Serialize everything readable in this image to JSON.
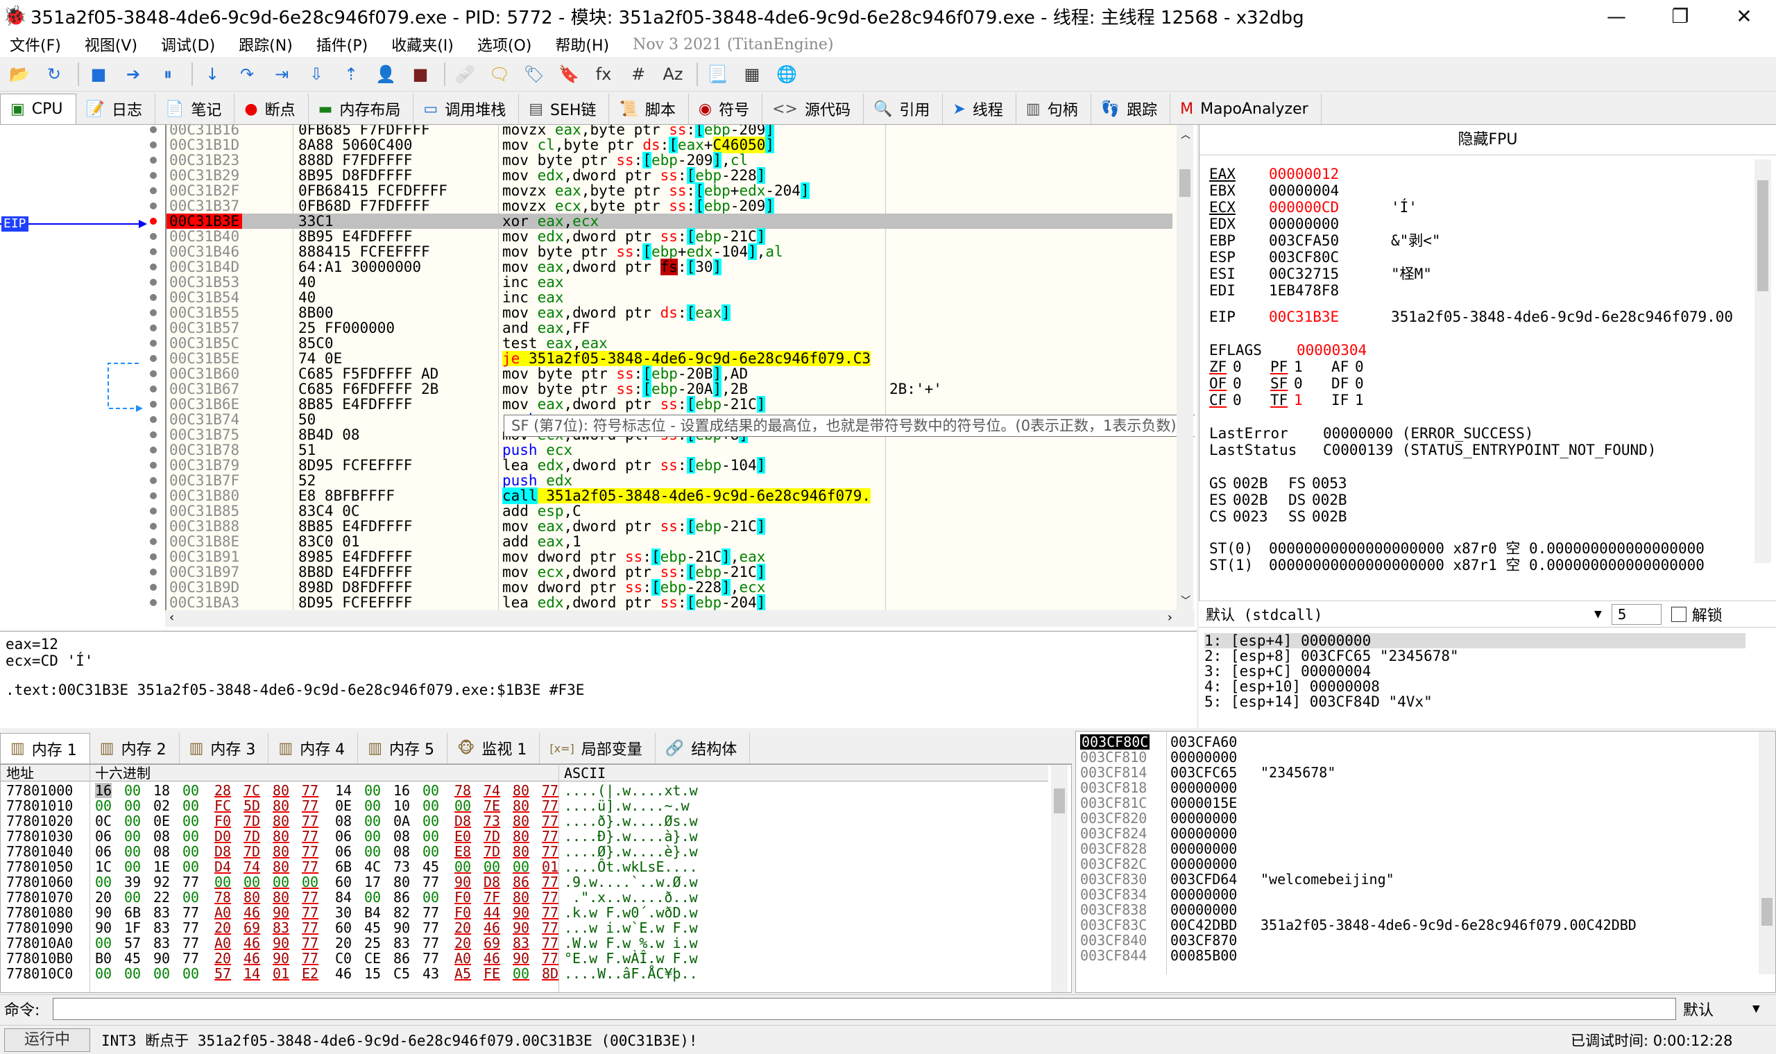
{
  "title": {
    "text": "351a2f05-3848-4de6-9c9d-6e28c946f079.exe - PID: 5772 - 模块: 351a2f05-3848-4de6-9c9d-6e28c946f079.exe - 线程: 主线程 12568 - x32dbg"
  },
  "window_buttons": {
    "minimize": "—",
    "maximize": "❐",
    "close": "✕"
  },
  "menu": [
    "文件(F)",
    "视图(V)",
    "调试(D)",
    "跟踪(N)",
    "插件(P)",
    "收藏夹(I)",
    "选项(O)",
    "帮助(H)"
  ],
  "menu_date": "Nov 3 2021 (TitanEngine)",
  "toolbar_icons": [
    "open-icon",
    "restart-icon",
    "stop-icon",
    "run-icon",
    "pause-icon",
    "step-into-icon",
    "step-over-icon",
    "trace-into-icon",
    "trace-over-icon",
    "execute-till-return-icon",
    "run-to-user-code-icon",
    "scylla-icon",
    "patch-icon",
    "comment-icon",
    "label-icon",
    "bookmark-icon",
    "function-icon",
    "hash-icon",
    "font-icon",
    "script-icon",
    "calculator-icon",
    "globe-icon"
  ],
  "toolbar_glyphs": [
    "📂",
    "↻",
    "■",
    "➔",
    "⏸",
    "↓",
    "↷",
    "⇥",
    "⇩",
    "⇡",
    "👤",
    "■",
    "🩹",
    "🗨",
    "🏷",
    "🔖",
    "fx",
    "#",
    "Az",
    "📃",
    "▦",
    "🌐"
  ],
  "tabs": [
    {
      "label": "CPU",
      "icon": "cpu-icon",
      "glyph": "▣"
    },
    {
      "label": "日志",
      "icon": "log-icon",
      "glyph": "📝"
    },
    {
      "label": "笔记",
      "icon": "notes-icon",
      "glyph": "📄"
    },
    {
      "label": "断点",
      "icon": "breakpoint-icon",
      "glyph": "●"
    },
    {
      "label": "内存布局",
      "icon": "memory-map-icon",
      "glyph": "▬"
    },
    {
      "label": "调用堆栈",
      "icon": "call-stack-icon",
      "glyph": "▭"
    },
    {
      "label": "SEH链",
      "icon": "seh-icon",
      "glyph": "▤"
    },
    {
      "label": "脚本",
      "icon": "script-icon",
      "glyph": "📜"
    },
    {
      "label": "符号",
      "icon": "symbol-icon",
      "glyph": "◉"
    },
    {
      "label": "源代码",
      "icon": "source-icon",
      "glyph": "<>"
    },
    {
      "label": "引用",
      "icon": "reference-icon",
      "glyph": "🔍"
    },
    {
      "label": "线程",
      "icon": "thread-icon",
      "glyph": "➤"
    },
    {
      "label": "句柄",
      "icon": "handle-icon",
      "glyph": "▥"
    },
    {
      "label": "跟踪",
      "icon": "trace-icon",
      "glyph": "👣"
    },
    {
      "label": "MapoAnalyzer",
      "icon": "mapo-icon",
      "glyph": "M"
    }
  ],
  "eip_label": "EIP",
  "disasm": [
    {
      "addr": "00C31B16",
      "bytes": "0FB685 F7FDFFFF",
      "instr": "movzx eax,byte ptr ss:[ebp-209]",
      "cmt": ""
    },
    {
      "addr": "00C31B1D",
      "bytes": "8A88 5060C400",
      "instr": "mov cl,byte ptr ds:[eax+C46050]",
      "cmt": ""
    },
    {
      "addr": "00C31B23",
      "bytes": "888D F7FDFFFF",
      "instr": "mov byte ptr ss:[ebp-209],cl",
      "cmt": ""
    },
    {
      "addr": "00C31B29",
      "bytes": "8B95 D8FDFFFF",
      "instr": "mov edx,dword ptr ss:[ebp-228]",
      "cmt": ""
    },
    {
      "addr": "00C31B2F",
      "bytes": "0FB68415 FCFDFFFF",
      "instr": "movzx eax,byte ptr ss:[ebp+edx-204]",
      "cmt": ""
    },
    {
      "addr": "00C31B37",
      "bytes": "0FB68D F7FDFFFF",
      "instr": "movzx ecx,byte ptr ss:[ebp-209]",
      "cmt": ""
    },
    {
      "addr": "00C31B3E",
      "bytes": "33C1",
      "instr": "xor eax,ecx",
      "cmt": ""
    },
    {
      "addr": "00C31B40",
      "bytes": "8B95 E4FDFFFF",
      "instr": "mov edx,dword ptr ss:[ebp-21C]",
      "cmt": ""
    },
    {
      "addr": "00C31B46",
      "bytes": "888415 FCFEFFFF",
      "instr": "mov byte ptr ss:[ebp+edx-104],al",
      "cmt": ""
    },
    {
      "addr": "00C31B4D",
      "bytes": "64:A1 30000000",
      "instr": "mov eax,dword ptr fs:[30]",
      "cmt": ""
    },
    {
      "addr": "00C31B53",
      "bytes": "40",
      "instr": "inc eax",
      "cmt": ""
    },
    {
      "addr": "00C31B54",
      "bytes": "40",
      "instr": "inc eax",
      "cmt": ""
    },
    {
      "addr": "00C31B55",
      "bytes": "8B00",
      "instr": "mov eax,dword ptr ds:[eax]",
      "cmt": ""
    },
    {
      "addr": "00C31B57",
      "bytes": "25 FF000000",
      "instr": "and eax,FF",
      "cmt": ""
    },
    {
      "addr": "00C31B5C",
      "bytes": "85C0",
      "instr": "test eax,eax",
      "cmt": ""
    },
    {
      "addr": "00C31B5E",
      "bytes": "74 0E",
      "instr": "je 351a2f05-3848-4de6-9c9d-6e28c946f079.C3",
      "cmt": ""
    },
    {
      "addr": "00C31B60",
      "bytes": "C685 F5FDFFFF AD",
      "instr": "mov byte ptr ss:[ebp-20B],AD",
      "cmt": ""
    },
    {
      "addr": "00C31B67",
      "bytes": "C685 F6FDFFFF 2B",
      "instr": "mov byte ptr ss:[ebp-20A],2B",
      "cmt": "2B:'+'"
    },
    {
      "addr": "00C31B6E",
      "bytes": "8B85 E4FDFFFF",
      "instr": "mov eax,dword ptr ss:[ebp-21C]",
      "cmt": ""
    },
    {
      "addr": "00C31B74",
      "bytes": "50",
      "instr": "push eax",
      "cmt": ""
    },
    {
      "addr": "00C31B75",
      "bytes": "8B4D 08",
      "instr": "mov ecx,dword ptr ss:[ebp+8]",
      "cmt": ""
    },
    {
      "addr": "00C31B78",
      "bytes": "51",
      "instr": "push ecx",
      "cmt": ""
    },
    {
      "addr": "00C31B79",
      "bytes": "8D95 FCFEFFFF",
      "instr": "lea edx,dword ptr ss:[ebp-104]",
      "cmt": ""
    },
    {
      "addr": "00C31B7F",
      "bytes": "52",
      "instr": "push edx",
      "cmt": ""
    },
    {
      "addr": "00C31B80",
      "bytes": "E8 8BFBFFFF",
      "instr": "call 351a2f05-3848-4de6-9c9d-6e28c946f079.",
      "cmt": ""
    },
    {
      "addr": "00C31B85",
      "bytes": "83C4 0C",
      "instr": "add esp,C",
      "cmt": ""
    },
    {
      "addr": "00C31B88",
      "bytes": "8B85 E4FDFFFF",
      "instr": "mov eax,dword ptr ss:[ebp-21C]",
      "cmt": ""
    },
    {
      "addr": "00C31B8E",
      "bytes": "83C0 01",
      "instr": "add eax,1",
      "cmt": ""
    },
    {
      "addr": "00C31B91",
      "bytes": "8985 E4FDFFFF",
      "instr": "mov dword ptr ss:[ebp-21C],eax",
      "cmt": ""
    },
    {
      "addr": "00C31B97",
      "bytes": "8B8D E4FDFFFF",
      "instr": "mov ecx,dword ptr ss:[ebp-21C]",
      "cmt": ""
    },
    {
      "addr": "00C31B9D",
      "bytes": "898D D8FDFFFF",
      "instr": "mov dword ptr ss:[ebp-228],ecx",
      "cmt": ""
    },
    {
      "addr": "00C31BA3",
      "bytes": "8D95 FCFEFFFF",
      "instr": "lea edx,dword ptr ss:[ebp-204]",
      "cmt": ""
    }
  ],
  "tooltip": "SF (第7位): 符号标志位 - 设置成结果的最高位，也就是带符号数中的符号位。(0表示正数，1表示负数)",
  "fpu_header": "隐藏FPU",
  "registers": [
    {
      "name": "EAX",
      "value": "00000012",
      "comment": "",
      "changed": true
    },
    {
      "name": "EBX",
      "value": "00000004",
      "comment": "",
      "changed": false
    },
    {
      "name": "ECX",
      "value": "000000CD",
      "comment": "'Í'",
      "changed": true
    },
    {
      "name": "EDX",
      "value": "00000000",
      "comment": "",
      "changed": false
    },
    {
      "name": "EBP",
      "value": "003CFA50",
      "comment": "&\"剥<\"",
      "changed": false
    },
    {
      "name": "ESP",
      "value": "003CF80C",
      "comment": "",
      "changed": false
    },
    {
      "name": "ESI",
      "value": "00C32715",
      "comment": "\"柽M\"",
      "changed": false
    },
    {
      "name": "EDI",
      "value": "1EB478F8",
      "comment": "",
      "changed": false
    }
  ],
  "eip_reg": {
    "name": "EIP",
    "value": "00C31B3E",
    "comment": "351a2f05-3848-4de6-9c9d-6e28c946f079.00"
  },
  "eflags": {
    "name": "EFLAGS",
    "value": "00000304"
  },
  "flags": [
    [
      "ZF",
      "0",
      "PF",
      "1",
      "AF",
      "0"
    ],
    [
      "OF",
      "0",
      "SF",
      "0",
      "DF",
      "0"
    ],
    [
      "CF",
      "0",
      "TF",
      "1",
      "IF",
      "1"
    ]
  ],
  "lasterror": {
    "label": "LastError",
    "value": "00000000 (ERROR_SUCCESS)"
  },
  "laststatus": {
    "label": "LastStatus",
    "value": "C0000139 (STATUS_ENTRYPOINT_NOT_FOUND)"
  },
  "segs": [
    [
      "GS",
      "002B",
      "FS",
      "0053"
    ],
    [
      "ES",
      "002B",
      "DS",
      "002B"
    ],
    [
      "CS",
      "0023",
      "SS",
      "002B"
    ]
  ],
  "st": [
    {
      "name": "ST(0)",
      "value": "00000000000000000000 x87r0 空 0.000000000000000000"
    },
    {
      "name": "ST(1)",
      "value": "00000000000000000000 x87r1 空 0.000000000000000000"
    }
  ],
  "callconv": {
    "label": "默认 (stdcall)",
    "count": "5",
    "unlock": "解锁"
  },
  "stackargs": [
    "1: [esp+4] 00000000",
    "2: [esp+8] 003CFC65 \"2345678\"",
    "3: [esp+C] 00000004",
    "4: [esp+10] 00000008",
    "5: [esp+14] 003CF84D \"4Vx\""
  ],
  "info": {
    "line1": "eax=12",
    "line2": "ecx=CD 'Í'",
    "line3": ".text:00C31B3E 351a2f05-3848-4de6-9c9d-6e28c946f079.exe:$1B3E #F3E"
  },
  "dump_tabs": [
    {
      "label": "内存 1",
      "icon": "memory-icon"
    },
    {
      "label": "内存 2",
      "icon": "memory-icon"
    },
    {
      "label": "内存 3",
      "icon": "memory-icon"
    },
    {
      "label": "内存 4",
      "icon": "memory-icon"
    },
    {
      "label": "内存 5",
      "icon": "memory-icon"
    },
    {
      "label": "监视 1",
      "icon": "watch-icon"
    },
    {
      "label": "局部变量",
      "icon": "locals-icon"
    },
    {
      "label": "结构体",
      "icon": "struct-icon"
    }
  ],
  "dump_header": {
    "addr": "地址",
    "hex": "十六进制",
    "ascii": "ASCII"
  },
  "dump_rows": [
    {
      "addr": "77801000",
      "hex": [
        "16",
        "00",
        "18",
        "00",
        "28",
        "7C",
        "80",
        "77",
        "14",
        "00",
        "16",
        "00",
        "78",
        "74",
        "80",
        "77"
      ],
      "ascii": "....(|.w....xt.w"
    },
    {
      "addr": "77801010",
      "hex": [
        "00",
        "00",
        "02",
        "00",
        "FC",
        "5D",
        "80",
        "77",
        "0E",
        "00",
        "10",
        "00",
        "00",
        "7E",
        "80",
        "77"
      ],
      "ascii": "....ü].w....~.w"
    },
    {
      "addr": "77801020",
      "hex": [
        "0C",
        "00",
        "0E",
        "00",
        "F0",
        "7D",
        "80",
        "77",
        "08",
        "00",
        "0A",
        "00",
        "D8",
        "73",
        "80",
        "77"
      ],
      "ascii": "....ð}.w....Øs.w"
    },
    {
      "addr": "77801030",
      "hex": [
        "06",
        "00",
        "08",
        "00",
        "D0",
        "7D",
        "80",
        "77",
        "06",
        "00",
        "08",
        "00",
        "E0",
        "7D",
        "80",
        "77"
      ],
      "ascii": "....Ð}.w....à}.w"
    },
    {
      "addr": "77801040",
      "hex": [
        "06",
        "00",
        "08",
        "00",
        "D8",
        "7D",
        "80",
        "77",
        "06",
        "00",
        "08",
        "00",
        "E8",
        "7D",
        "80",
        "77"
      ],
      "ascii": "....Ø}.w....è}.w"
    },
    {
      "addr": "77801050",
      "hex": [
        "1C",
        "00",
        "1E",
        "00",
        "D4",
        "74",
        "80",
        "77",
        "6B",
        "4C",
        "73",
        "45",
        "00",
        "00",
        "00",
        "01"
      ],
      "ascii": "....Ôt.wkLsE...."
    },
    {
      "addr": "77801060",
      "hex": [
        "00",
        "39",
        "92",
        "77",
        "00",
        "00",
        "00",
        "00",
        "60",
        "17",
        "80",
        "77",
        "90",
        "D8",
        "86",
        "77"
      ],
      "ascii": ".9.w....`..w.Ø.w"
    },
    {
      "addr": "77801070",
      "hex": [
        "20",
        "00",
        "22",
        "00",
        "78",
        "80",
        "80",
        "77",
        "84",
        "00",
        "86",
        "00",
        "F0",
        "7F",
        "80",
        "77"
      ],
      "ascii": " .\".x..w....ð..w"
    },
    {
      "addr": "77801080",
      "hex": [
        "90",
        "6B",
        "83",
        "77",
        "A0",
        "46",
        "90",
        "77",
        "30",
        "B4",
        "82",
        "77",
        "F0",
        "44",
        "90",
        "77"
      ],
      "ascii": ".k.w F.w0´.wðD.w"
    },
    {
      "addr": "77801090",
      "hex": [
        "90",
        "1F",
        "83",
        "77",
        "20",
        "69",
        "83",
        "77",
        "60",
        "45",
        "90",
        "77",
        "20",
        "46",
        "90",
        "77"
      ],
      "ascii": "...w i.w`E.w F.w"
    },
    {
      "addr": "778010A0",
      "hex": [
        "00",
        "57",
        "83",
        "77",
        "A0",
        "46",
        "90",
        "77",
        "20",
        "25",
        "83",
        "77",
        "20",
        "69",
        "83",
        "77"
      ],
      "ascii": ".W.w F.w %.w i.w"
    },
    {
      "addr": "778010B0",
      "hex": [
        "B0",
        "45",
        "90",
        "77",
        "20",
        "46",
        "90",
        "77",
        "C0",
        "CE",
        "86",
        "77",
        "A0",
        "46",
        "90",
        "77"
      ],
      "ascii": "°E.w F.wÀÎ.w F.w"
    },
    {
      "addr": "778010C0",
      "hex": [
        "00",
        "00",
        "00",
        "00",
        "57",
        "14",
        "01",
        "E2",
        "46",
        "15",
        "C5",
        "43",
        "A5",
        "FE",
        "00",
        "8D"
      ],
      "ascii": "....W..âF.ÅC¥þ.."
    }
  ],
  "stack_rows": [
    {
      "addr": "003CF80C",
      "value": "003CFA60",
      "comment": ""
    },
    {
      "addr": "003CF810",
      "value": "00000000",
      "comment": ""
    },
    {
      "addr": "003CF814",
      "value": "003CFC65",
      "comment": "\"2345678\""
    },
    {
      "addr": "003CF818",
      "value": "00000000",
      "comment": ""
    },
    {
      "addr": "003CF81C",
      "value": "0000015E",
      "comment": ""
    },
    {
      "addr": "003CF820",
      "value": "00000000",
      "comment": ""
    },
    {
      "addr": "003CF824",
      "value": "00000000",
      "comment": ""
    },
    {
      "addr": "003CF828",
      "value": "00000000",
      "comment": ""
    },
    {
      "addr": "003CF82C",
      "value": "00000000",
      "comment": ""
    },
    {
      "addr": "003CF830",
      "value": "003CFD64",
      "comment": "\"welcomebeijing\""
    },
    {
      "addr": "003CF834",
      "value": "00000000",
      "comment": ""
    },
    {
      "addr": "003CF838",
      "value": "00000000",
      "comment": ""
    },
    {
      "addr": "003CF83C",
      "value": "00C42DBD",
      "comment": "351a2f05-3848-4de6-9c9d-6e28c946f079.00C42DBD"
    },
    {
      "addr": "003CF840",
      "value": "003CF870",
      "comment": ""
    },
    {
      "addr": "003CF844",
      "value": "00085B00",
      "comment": ""
    }
  ],
  "cmd": {
    "label": "命令:",
    "placeholder": "",
    "mode": "默认"
  },
  "status": {
    "state": "运行中",
    "message": "INT3 断点于 351a2f05-3848-4de6-9c9d-6e28c946f079.00C31B3E (00C31B3E)!",
    "time": "已调试时间: 0:00:12:28"
  },
  "colors": {
    "eip_bg": "#ff0000",
    "highlight": "#ffff00",
    "bracket": "#00ffff",
    "register_changed": "#ff0000",
    "disasm_bg": "#fffdf4"
  }
}
